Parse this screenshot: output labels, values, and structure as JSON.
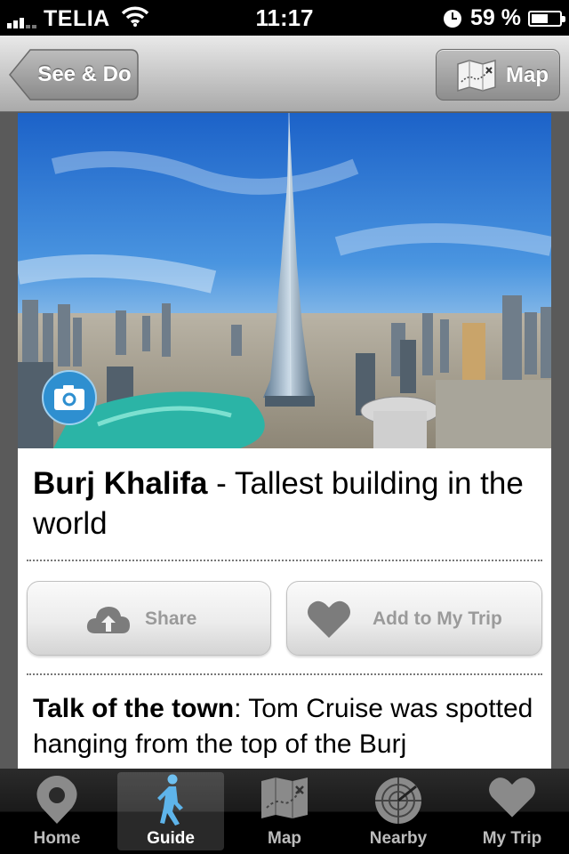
{
  "status_bar": {
    "carrier": "TELIA",
    "time": "11:17",
    "battery": "59 %",
    "battery_level": 0.59,
    "signal_bars": 3
  },
  "nav_bar": {
    "back_label": "See & Do",
    "map_label": "Map"
  },
  "attraction": {
    "name": "Burj Khalifa",
    "tagline": " - Tallest building in the world"
  },
  "actions": {
    "share_label": "Share",
    "add_trip_label": "Add to My Trip"
  },
  "description": {
    "lead": "Talk of the town",
    "text": ": Tom Cruise was spotted hanging from the top of the Burj"
  },
  "tabs": [
    {
      "label": "Home",
      "icon": "pin-icon"
    },
    {
      "label": "Guide",
      "icon": "walking-person-icon",
      "active": true
    },
    {
      "label": "Map",
      "icon": "map-icon"
    },
    {
      "label": "Nearby",
      "icon": "radar-icon"
    },
    {
      "label": "My Trip",
      "icon": "heart-icon"
    }
  ],
  "colors": {
    "camera_button": "#2e8fd0",
    "nav_bar": "#c9c9c9",
    "tab_bar": "#1a1a1a"
  }
}
